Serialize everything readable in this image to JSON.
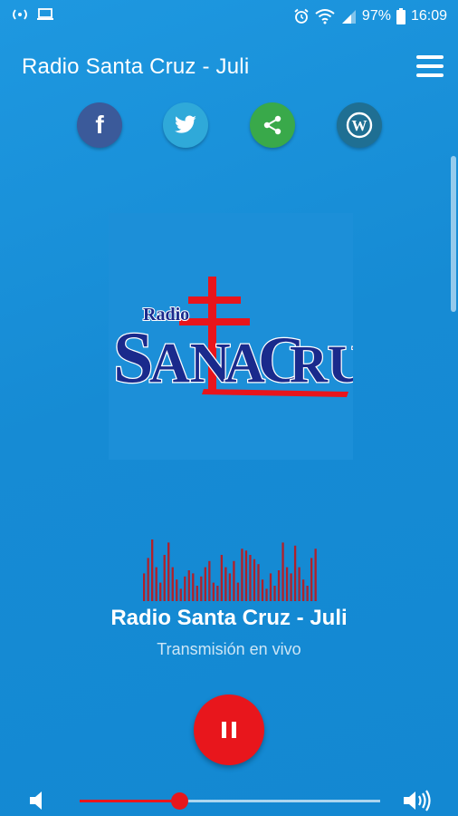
{
  "status_bar": {
    "battery": "97%",
    "time": "16:09"
  },
  "app_bar": {
    "title": "Radio Santa Cruz - Juli"
  },
  "logo": {
    "small_text": "Radio",
    "main_text": "SANTA CRUZ"
  },
  "social": [
    {
      "name": "facebook",
      "glyph": "f",
      "color": "#3b5a9a"
    },
    {
      "name": "twitter",
      "color": "#2fa9d9"
    },
    {
      "name": "share",
      "color": "#39a94a"
    },
    {
      "name": "wordpress",
      "glyph": "W",
      "color": "#1f6f93"
    }
  ],
  "player": {
    "station_name": "Radio Santa Cruz - Juli",
    "status": "Transmisión en vivo",
    "state": "playing",
    "volume": 0.33,
    "equalizer_levels": [
      0.45,
      0.7,
      1.0,
      0.55,
      0.3,
      0.75,
      0.95,
      0.55,
      0.35,
      0.2,
      0.4,
      0.5,
      0.45,
      0.25,
      0.4,
      0.55,
      0.65,
      0.3,
      0.25,
      0.75,
      0.55,
      0.45,
      0.65,
      0.3,
      0.85,
      0.82,
      0.75,
      0.68,
      0.6,
      0.35,
      0.2,
      0.45,
      0.25,
      0.5,
      0.95,
      0.55,
      0.45,
      0.9,
      0.55,
      0.35,
      0.25,
      0.7,
      0.85
    ]
  },
  "colors": {
    "background": "#168bd4",
    "accent": "#e8161c",
    "logo_blue": "#1a2a8c",
    "equalizer": "#b0202a"
  }
}
